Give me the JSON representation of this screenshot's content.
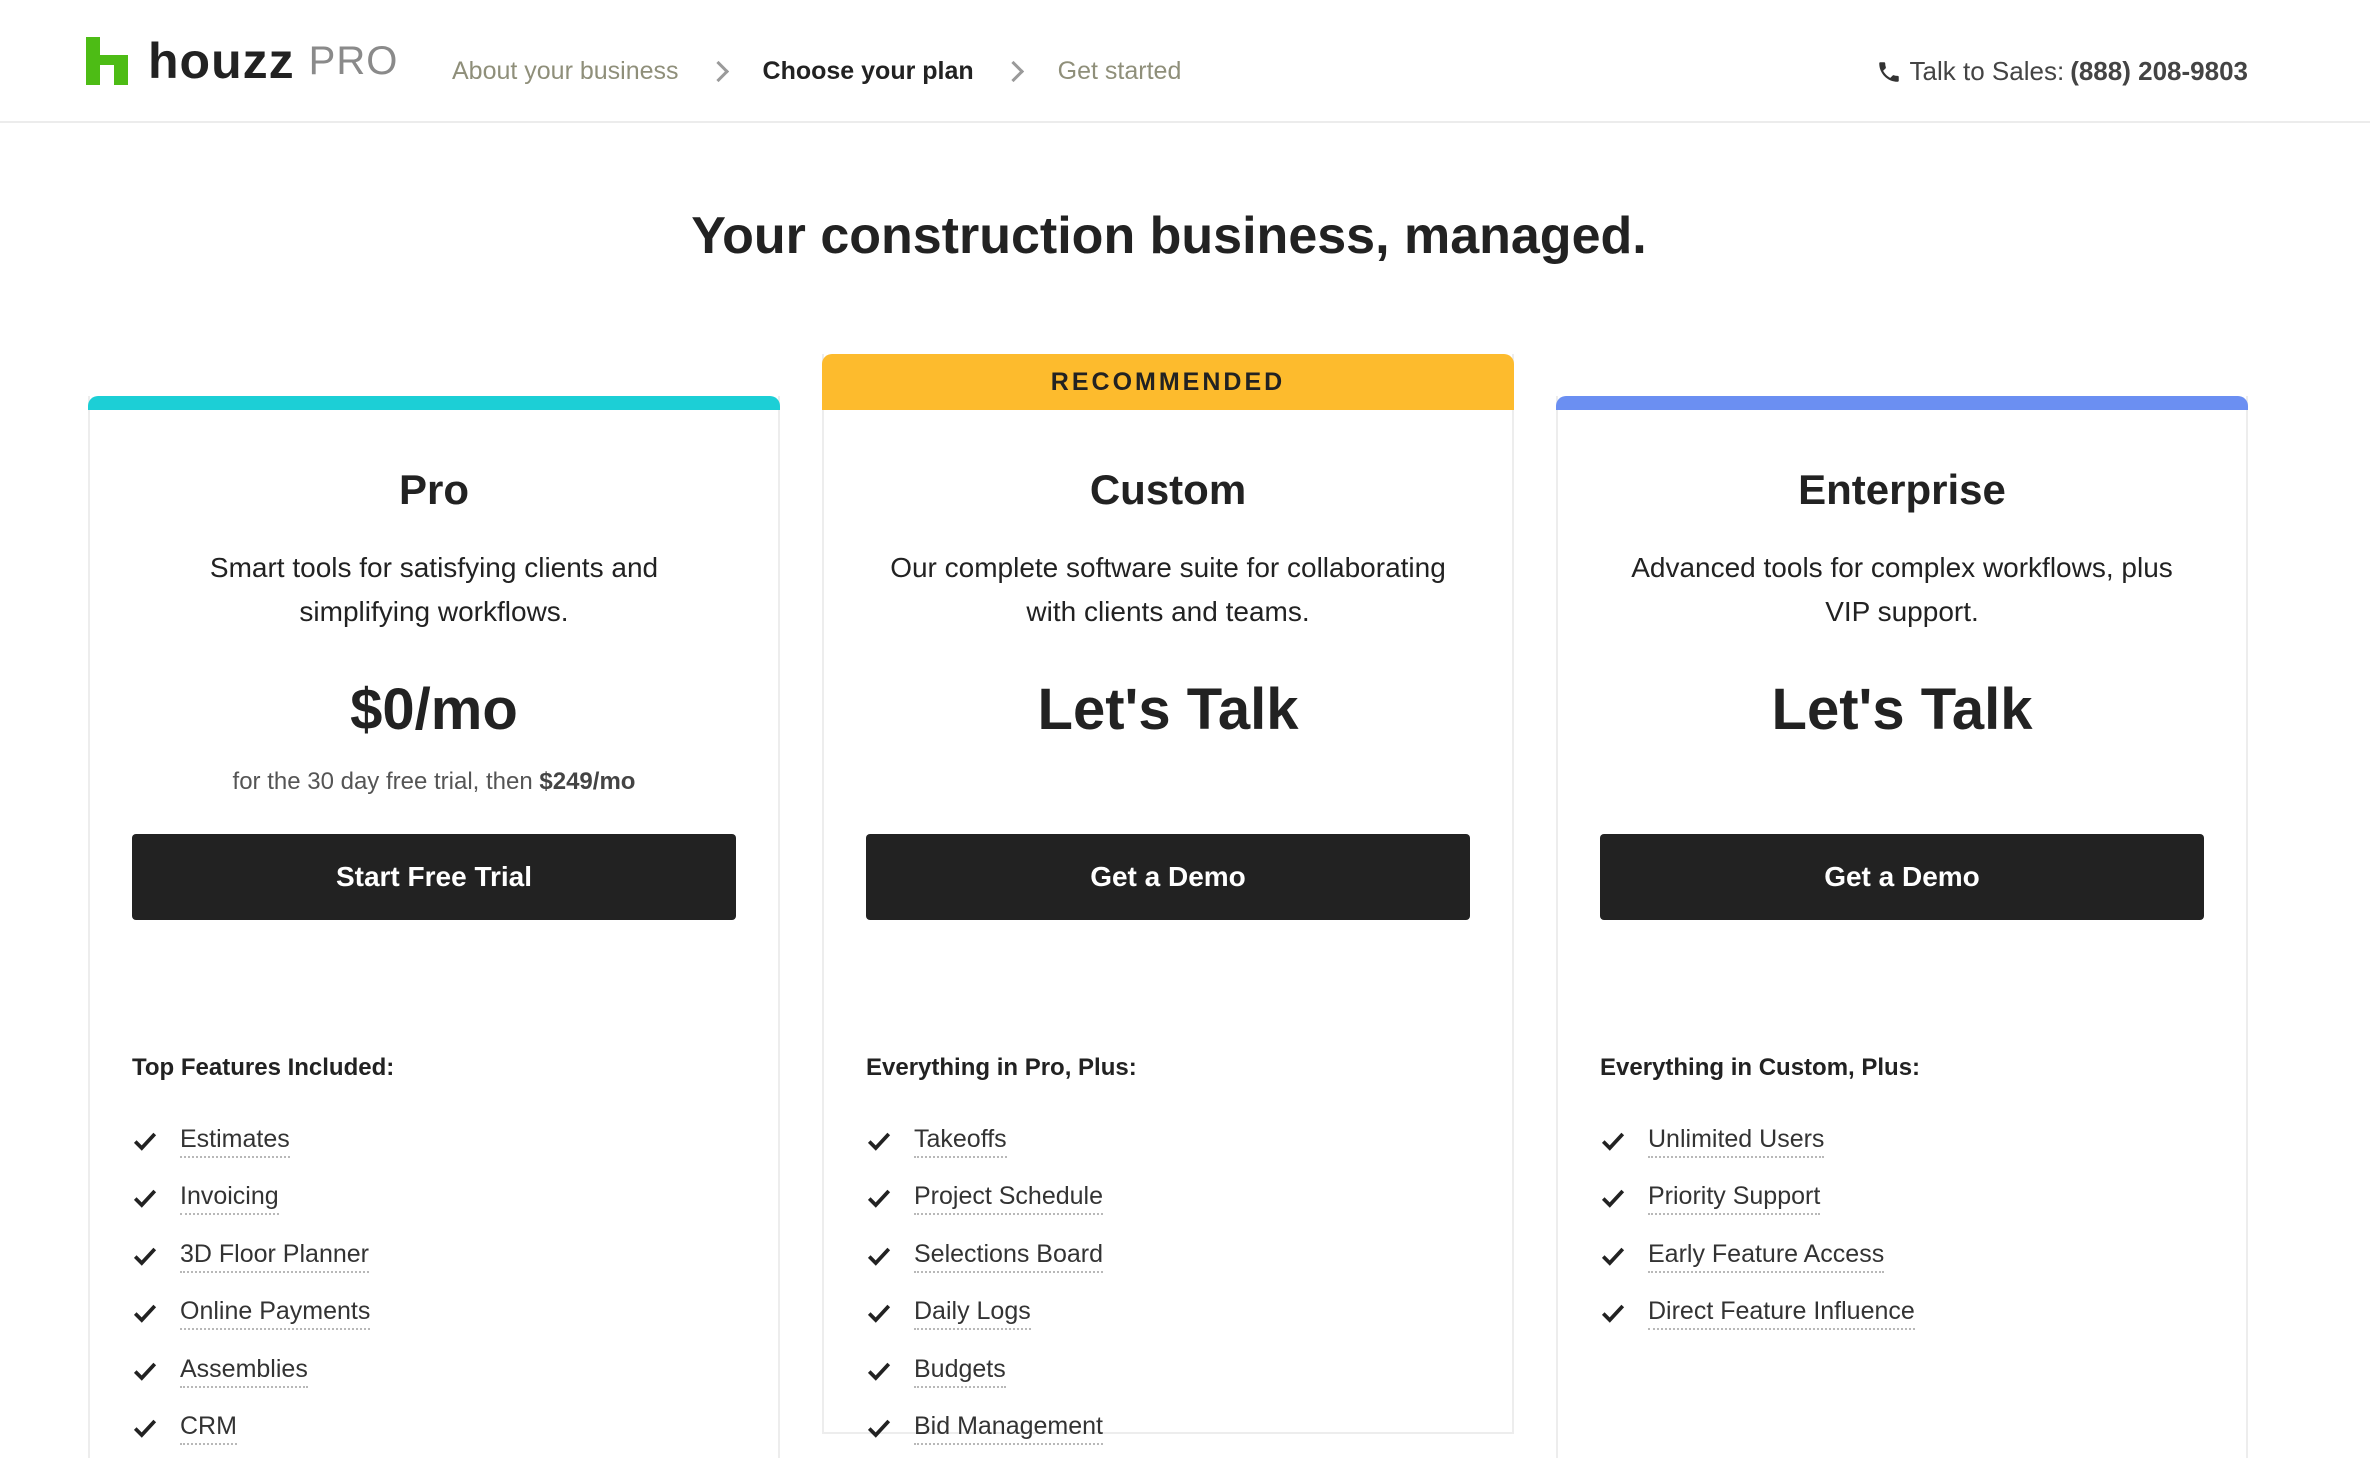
{
  "header": {
    "logo_word": "houzz",
    "logo_suffix": "PRO",
    "steps": [
      {
        "label": "About your business",
        "active": false
      },
      {
        "label": "Choose your plan",
        "active": true
      },
      {
        "label": "Get started",
        "active": false
      }
    ],
    "sales_label": "Talk to Sales:",
    "sales_phone": "(888) 208-9803"
  },
  "page_title": "Your construction business, managed.",
  "plans": [
    {
      "name": "Pro",
      "accent": "#1ccfd6",
      "recommended": false,
      "description": "Smart tools for satisfying clients and simplifying workflows.",
      "price": "$0/mo",
      "note_prefix": "for the 30 day free trial, then",
      "note_price": "$249/mo",
      "cta": "Start Free Trial",
      "features_heading": "Top Features Included:",
      "features": [
        "Estimates",
        "Invoicing",
        "3D Floor Planner",
        "Online Payments",
        "Assemblies",
        "CRM"
      ]
    },
    {
      "name": "Custom",
      "accent": "#fdbb2d",
      "recommended": true,
      "badge": "RECOMMENDED",
      "description": "Our complete software suite for collaborating with clients and teams.",
      "price": "Let's Talk",
      "cta": "Get a Demo",
      "features_heading": "Everything in Pro, Plus:",
      "features": [
        "Takeoffs",
        "Project Schedule",
        "Selections Board",
        "Daily Logs",
        "Budgets",
        "Bid Management"
      ]
    },
    {
      "name": "Enterprise",
      "accent": "#6b8ff2",
      "recommended": false,
      "description": "Advanced tools for complex workflows, plus VIP support.",
      "price": "Let's Talk",
      "cta": "Get a Demo",
      "features_heading": "Everything in Custom, Plus:",
      "features": [
        "Unlimited Users",
        "Priority Support",
        "Early Feature Access",
        "Direct Feature Influence"
      ]
    }
  ],
  "icons": {
    "phone": "phone-icon",
    "check": "check-icon",
    "chevron": "chevron-right-icon",
    "logo": "houzz-logo-icon"
  }
}
